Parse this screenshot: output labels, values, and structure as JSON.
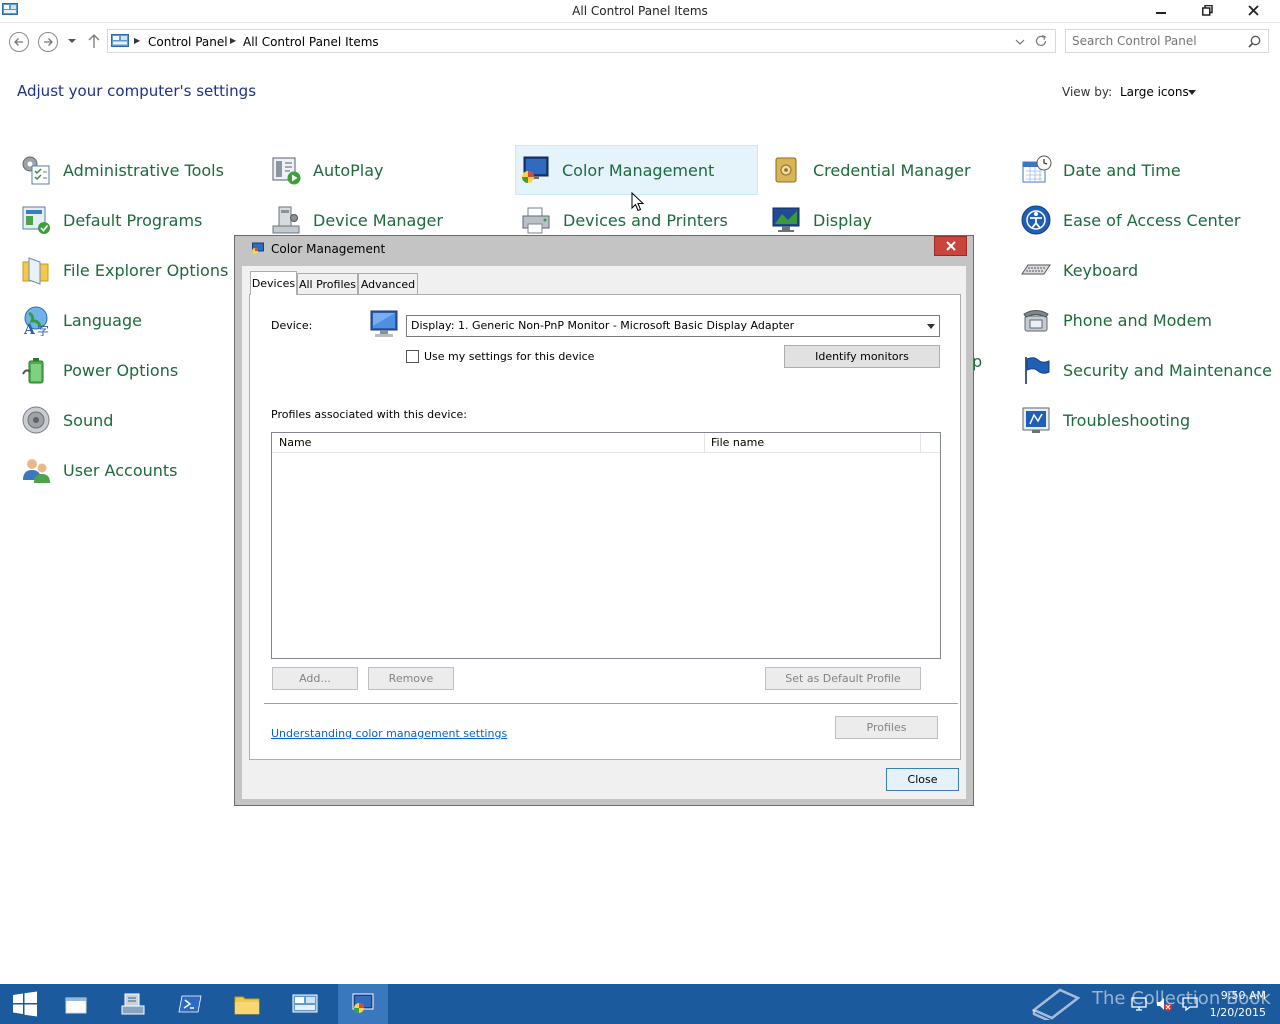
{
  "window": {
    "title": "All Control Panel Items"
  },
  "address": {
    "crumbs": [
      "Control Panel",
      "All Control Panel Items"
    ],
    "search_placeholder": "Search Control Panel"
  },
  "header": {
    "heading": "Adjust your computer's settings",
    "view_by_label": "View by:",
    "view_by_value": "Large icons"
  },
  "items": {
    "administrative_tools": "Administrative Tools",
    "autoplay": "AutoPlay",
    "color_management": "Color Management",
    "credential_manager": "Credential Manager",
    "date_and_time": "Date and Time",
    "default_programs": "Default Programs",
    "device_manager": "Device Manager",
    "devices_and_printers": "Devices and Printers",
    "display": "Display",
    "ease_of_access": "Ease of Access Center",
    "file_explorer_options": "File Explorer Options",
    "keyboard": "Keyboard",
    "language": "Language",
    "phone_and_modem": "Phone and Modem",
    "power_options": "Power Options",
    "security_and_maintenance": "Security and Maintenance",
    "sound": "Sound",
    "troubleshooting": "Troubleshooting",
    "user_accounts": "User Accounts",
    "partial_text": "p"
  },
  "dialog": {
    "title": "Color Management",
    "tabs": [
      "Devices",
      "All Profiles",
      "Advanced"
    ],
    "device_label": "Device:",
    "device_value": "Display: 1. Generic Non-PnP Monitor - Microsoft Basic Display Adapter",
    "use_my_settings": "Use my settings for this device",
    "use_my_settings_checked": false,
    "identify_monitors": "Identify monitors",
    "profiles_label": "Profiles associated with this device:",
    "columns": [
      "Name",
      "File name"
    ],
    "add": "Add...",
    "remove": "Remove",
    "set_default": "Set as Default Profile",
    "help_link": "Understanding color management settings",
    "profiles": "Profiles",
    "close": "Close"
  },
  "taskbar": {
    "time": "9:50 AM",
    "date": "1/20/2015",
    "watermark": "The Collection Book",
    "color": "#1c5a9e"
  }
}
